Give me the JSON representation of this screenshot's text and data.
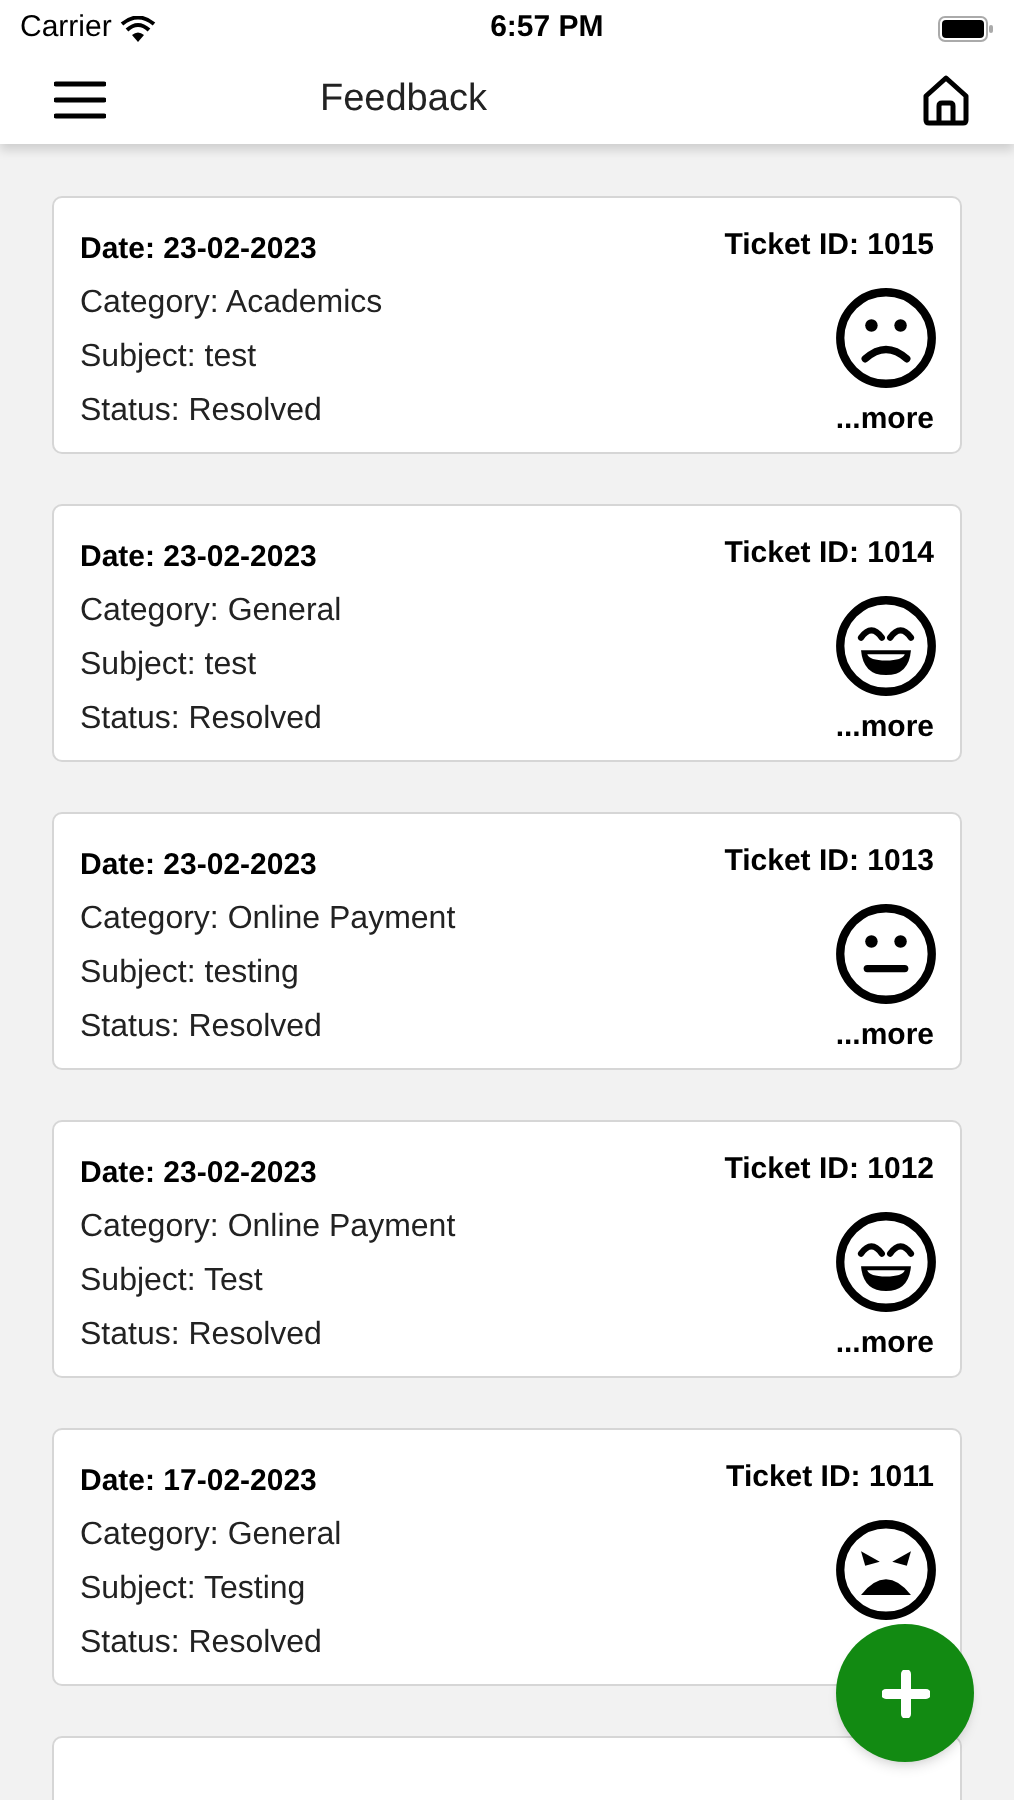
{
  "status_bar": {
    "carrier": "Carrier",
    "time": "6:57 PM"
  },
  "header": {
    "title": "Feedback"
  },
  "tickets": [
    {
      "date": "Date: 23-02-2023",
      "ticket_id": "Ticket ID: 1015",
      "category": "Category: Academics",
      "subject": "Subject: test",
      "status": "Status: Resolved",
      "kind": "sad",
      "more": "...more"
    },
    {
      "date": "Date: 23-02-2023",
      "ticket_id": "Ticket ID: 1014",
      "category": "Category: General",
      "subject": "Subject: test",
      "status": "Status: Resolved",
      "kind": "happy",
      "more": "...more"
    },
    {
      "date": "Date: 23-02-2023",
      "ticket_id": "Ticket ID: 1013",
      "category": "Category: Online Payment",
      "subject": "Subject: testing",
      "status": "Status: Resolved",
      "kind": "neutral",
      "more": "...more"
    },
    {
      "date": "Date: 23-02-2023",
      "ticket_id": "Ticket ID: 1012",
      "category": "Category: Online Payment",
      "subject": "Subject: Test",
      "status": "Status: Resolved",
      "kind": "happy",
      "more": "...more"
    },
    {
      "date": "Date: 17-02-2023",
      "ticket_id": "Ticket ID: 1011",
      "category": "Category: General",
      "subject": "Subject: Testing",
      "status": "Status: Resolved",
      "kind": "angry"
    }
  ]
}
